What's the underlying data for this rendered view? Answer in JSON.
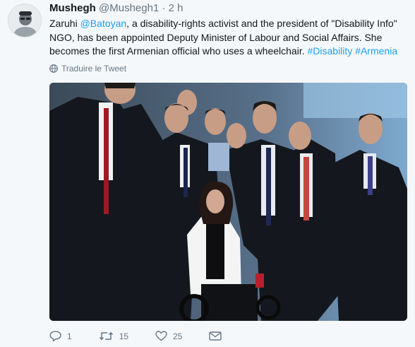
{
  "tweet": {
    "user_name": "Mushegh",
    "user_handle": "@Mushegh1",
    "separator": "·",
    "time": "2 h",
    "text_before_mention": "Zaruhi ",
    "mention": "@Batoyan",
    "text_after_mention": ", a disability-rights activist and the president of \"Disability Info\" NGO, has been appointed Deputy Minister of Labour and Social Affairs. She becomes the first Armenian official who uses a wheelchair. ",
    "hashtags": [
      "#Disability",
      "#Armenia"
    ],
    "translate_label": "Traduire le Tweet"
  },
  "actions": {
    "reply_count": "1",
    "retweet_count": "15",
    "like_count": "25"
  },
  "icons": {
    "globe": "globe-icon",
    "reply": "reply-icon",
    "retweet": "retweet-icon",
    "like": "heart-icon",
    "dm": "envelope-icon"
  },
  "colors": {
    "link": "#1da1f2",
    "muted": "#657786",
    "text": "#14171a",
    "background": "#f5f8fa"
  }
}
